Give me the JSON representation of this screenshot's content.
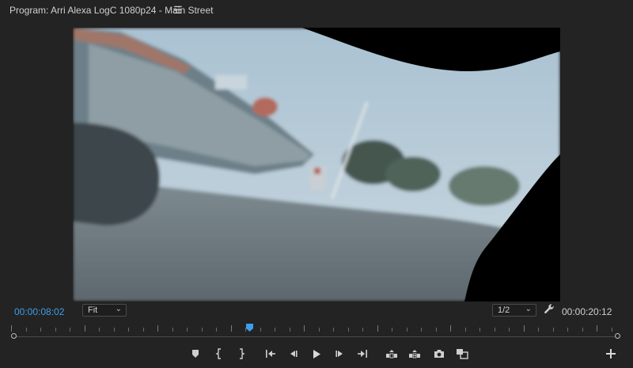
{
  "panel": {
    "title": "Program: Arri Alexa LogC 1080p24 - Main Street",
    "menu_icon": "hamburger-menu-icon"
  },
  "viewer": {
    "content": "video-frame-street-scene-warped"
  },
  "timecode": {
    "current": "00:00:08:02",
    "duration": "00:00:20:12"
  },
  "zoom_select": {
    "value": "Fit"
  },
  "resolution_select": {
    "value": "1/2"
  },
  "playhead": {
    "position_fraction": 0.39
  },
  "controls": [
    {
      "name": "add-marker-button",
      "icon": "marker-icon"
    },
    {
      "name": "mark-in-button",
      "icon": "mark-in-icon"
    },
    {
      "name": "mark-out-button",
      "icon": "mark-out-icon"
    },
    {
      "name": "go-to-in-button",
      "icon": "go-to-in-icon"
    },
    {
      "name": "step-back-button",
      "icon": "step-back-icon"
    },
    {
      "name": "play-button",
      "icon": "play-icon"
    },
    {
      "name": "step-forward-button",
      "icon": "step-forward-icon"
    },
    {
      "name": "go-to-out-button",
      "icon": "go-to-out-icon"
    },
    {
      "name": "lift-button",
      "icon": "lift-icon"
    },
    {
      "name": "extract-button",
      "icon": "extract-icon"
    },
    {
      "name": "export-frame-button",
      "icon": "camera-icon"
    },
    {
      "name": "comparison-view-button",
      "icon": "comparison-icon"
    }
  ],
  "colors": {
    "panel_bg": "#232323",
    "timecode_accent": "#3f9ee8",
    "playhead": "#3f9ee8"
  }
}
